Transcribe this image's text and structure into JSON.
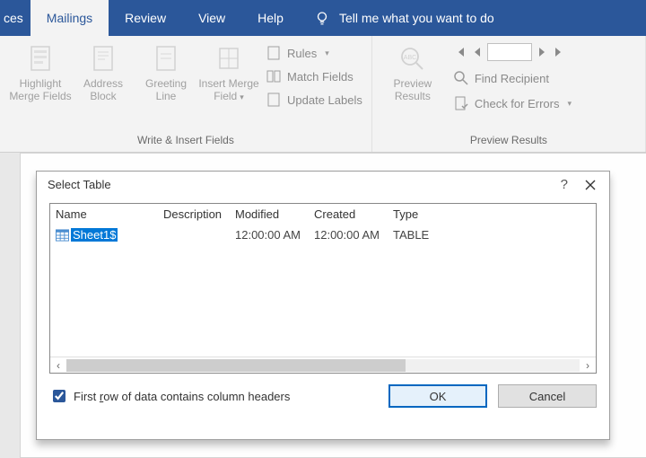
{
  "tabs": {
    "truncated": "ces",
    "items": [
      "Mailings",
      "Review",
      "View",
      "Help"
    ],
    "active_index": 0,
    "tellme": "Tell me what you want to do"
  },
  "ribbon": {
    "group_write": {
      "label": "Write & Insert Fields",
      "buttons": {
        "highlight": "Highlight Merge Fields",
        "address": "Address Block",
        "greeting": "Greeting Line",
        "insertmf": "Insert Merge Field"
      },
      "small": {
        "rules": "Rules",
        "match": "Match Fields",
        "update": "Update Labels"
      }
    },
    "group_preview": {
      "label": "Preview Results",
      "button": "Preview Results",
      "find": "Find Recipient",
      "check": "Check for Errors"
    }
  },
  "dialog": {
    "title": "Select Table",
    "help": "?",
    "columns": {
      "name": "Name",
      "desc": "Description",
      "mod": "Modified",
      "crt": "Created",
      "type": "Type"
    },
    "row": {
      "name": "Sheet1$",
      "desc": "",
      "mod": "12:00:00 AM",
      "crt": "12:00:00 AM",
      "type": "TABLE"
    },
    "first_row_label_pre": "First ",
    "first_row_label_u": "r",
    "first_row_label_post": "ow of data contains column headers",
    "first_row_checked": true,
    "ok": "OK",
    "cancel": "Cancel"
  }
}
